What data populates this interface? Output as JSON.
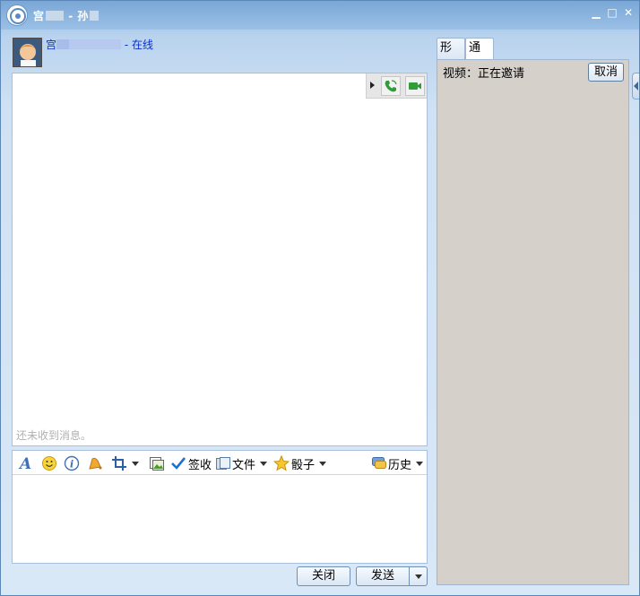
{
  "titlebar": {
    "prefix": "宫",
    "separator": " - ",
    "peer": "孙",
    "min_label": "▁",
    "max_label": "□",
    "close_label": "✕"
  },
  "contact": {
    "name_prefix": "宫",
    "separator": " - ",
    "status": "在线"
  },
  "message_area": {
    "empty_text": "还未收到消息。"
  },
  "toolbar": {
    "receipt_label": "签收",
    "file_label": "文件",
    "dice_label": "骰子",
    "history_label": "历史"
  },
  "buttons": {
    "close_label": "关闭",
    "send_label": "发送"
  },
  "right_panel": {
    "tabs": [
      {
        "label": "形象"
      },
      {
        "label": "通话"
      }
    ],
    "call_status": "视频：正在邀请",
    "cancel_label": "取消"
  },
  "colors": {
    "accent": "#0a30c8",
    "panel_bg": "#d5d0c9",
    "title_bg": "#7aa7d6"
  }
}
